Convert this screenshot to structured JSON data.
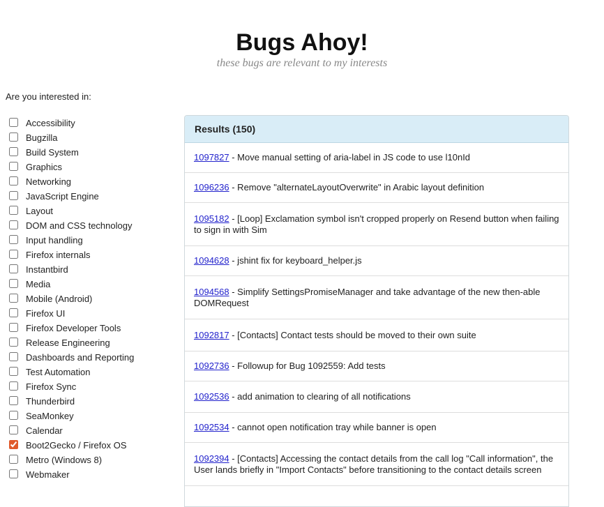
{
  "header": {
    "title": "Bugs Ahoy!",
    "subtitle": "these bugs are relevant to my interests"
  },
  "prompt": "Are you interested in:",
  "topics": [
    {
      "label": "Accessibility",
      "checked": false
    },
    {
      "label": "Bugzilla",
      "checked": false
    },
    {
      "label": "Build System",
      "checked": false
    },
    {
      "label": "Graphics",
      "checked": false
    },
    {
      "label": "Networking",
      "checked": false
    },
    {
      "label": "JavaScript Engine",
      "checked": false
    },
    {
      "label": "Layout",
      "checked": false
    },
    {
      "label": "DOM and CSS technology",
      "checked": false
    },
    {
      "label": "Input handling",
      "checked": false
    },
    {
      "label": "Firefox internals",
      "checked": false
    },
    {
      "label": "Instantbird",
      "checked": false
    },
    {
      "label": "Media",
      "checked": false
    },
    {
      "label": "Mobile (Android)",
      "checked": false
    },
    {
      "label": "Firefox UI",
      "checked": false
    },
    {
      "label": "Firefox Developer Tools",
      "checked": false
    },
    {
      "label": "Release Engineering",
      "checked": false
    },
    {
      "label": "Dashboards and Reporting",
      "checked": false
    },
    {
      "label": "Test Automation",
      "checked": false
    },
    {
      "label": "Firefox Sync",
      "checked": false
    },
    {
      "label": "Thunderbird",
      "checked": false
    },
    {
      "label": "SeaMonkey",
      "checked": false
    },
    {
      "label": "Calendar",
      "checked": false
    },
    {
      "label": "Boot2Gecko / Firefox OS",
      "checked": true
    },
    {
      "label": "Metro (Windows 8)",
      "checked": false
    },
    {
      "label": "Webmaker",
      "checked": false
    }
  ],
  "results": {
    "header": "Results (150)",
    "bugs": [
      {
        "id": "1097827",
        "summary": " - Move manual setting of aria-label in JS code to use l10nId"
      },
      {
        "id": "1096236",
        "summary": " - Remove \"alternateLayoutOverwrite\" in Arabic layout definition"
      },
      {
        "id": "1095182",
        "summary": " - [Loop] Exclamation symbol isn't cropped properly on Resend button when failing to sign in with Sim"
      },
      {
        "id": "1094628",
        "summary": " - jshint fix for keyboard_helper.js"
      },
      {
        "id": "1094568",
        "summary": " - Simplify SettingsPromiseManager and take advantage of the new then-able DOMRequest"
      },
      {
        "id": "1092817",
        "summary": " - [Contacts] Contact tests should be moved to their own suite"
      },
      {
        "id": "1092736",
        "summary": " - Followup for Bug 1092559: Add tests"
      },
      {
        "id": "1092536",
        "summary": " - add animation to clearing of all notifications"
      },
      {
        "id": "1092534",
        "summary": " - cannot open notification tray while banner is open"
      },
      {
        "id": "1092394",
        "summary": " - [Contacts] Accessing the contact details from the call log \"Call information\", the User lands briefly in \"Import Contacts\" before transitioning to the contact details screen"
      }
    ]
  },
  "colors": {
    "results_header_bg": "#d9edf7",
    "link": "#2222cc",
    "checkbox_accent": "#e05a2b"
  }
}
